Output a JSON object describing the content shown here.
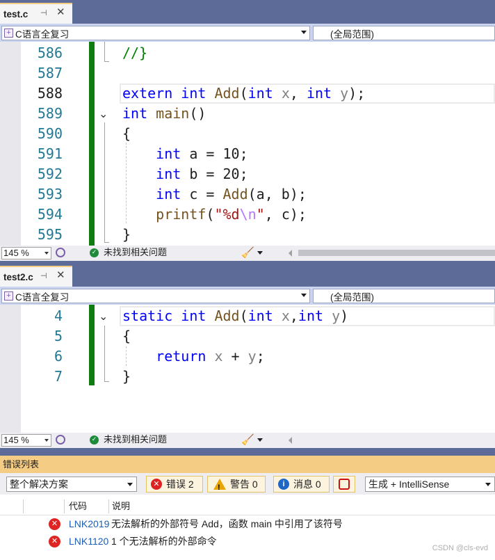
{
  "pane1": {
    "tab_title": "test.c",
    "project": "C语言全复习",
    "scope": "(全局范围)",
    "line_numbers": [
      "586",
      "587",
      "588",
      "589",
      "590",
      "591",
      "592",
      "593",
      "594",
      "595"
    ],
    "zoom": "145 %",
    "status": "未找到相关问题"
  },
  "pane2": {
    "tab_title": "test2.c",
    "project": "C语言全复习",
    "scope": "(全局范围)",
    "line_numbers": [
      "4",
      "5",
      "6",
      "7"
    ],
    "zoom": "145 %",
    "status": "未找到相关问题"
  },
  "error_list": {
    "title": "错误列表",
    "scope": "整个解决方案",
    "errors_label": "错误 2",
    "warnings_label": "警告 0",
    "messages_label": "消息 0",
    "build_filter": "生成 + IntelliSense",
    "columns": [
      "代码",
      "说明"
    ],
    "rows": [
      {
        "code": "LNK2019",
        "description": "无法解析的外部符号 Add，函数 main 中引用了该符号"
      },
      {
        "code": "LNK1120",
        "description": "1 个无法解析的外部命令"
      }
    ]
  },
  "watermark": "CSDN @cls-evd",
  "icons": {
    "pin": "pin-icon",
    "close": "close-icon",
    "project": "project-icon",
    "intellicode": "intellicode-icon",
    "ok": "check-circle-icon",
    "cleanup": "broom-icon",
    "error": "error-icon",
    "warning": "warning-icon",
    "info": "info-icon",
    "filter": "filter-icon"
  },
  "colors": {
    "tab_strip": "#5d6b99",
    "active_tab_accent": "#f5cc84",
    "keyword": "#0000ff",
    "function": "#74531f",
    "parameter": "#808080",
    "comment": "#008000",
    "string": "#a31515",
    "change_bar": "#107c10",
    "error_red": "#e02424"
  }
}
